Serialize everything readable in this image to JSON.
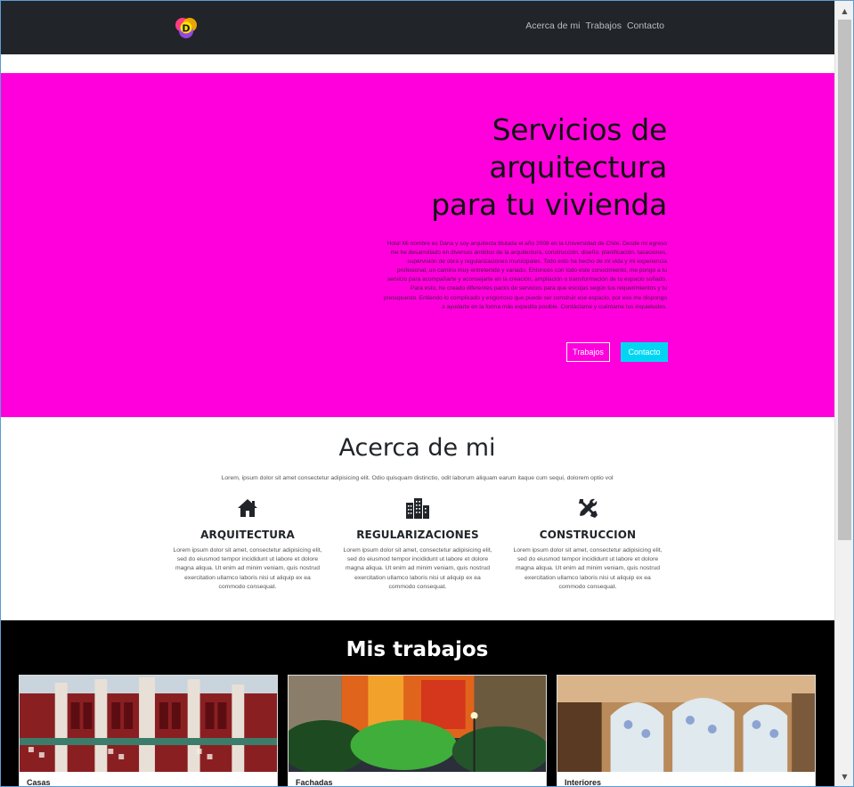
{
  "navbar": {
    "logo_letter": "D",
    "links": [
      "Acerca de mi",
      "Trabajos",
      "Contacto"
    ]
  },
  "hero": {
    "title_lines": [
      "Servicios de",
      "arquitectura",
      "para tu vivienda"
    ],
    "text": "Hola! Mi nombre es Dana y soy arquitecta titulada el año 2008 en la Universidad de Chile. Desde mi egreso me he desarrollado en diversos ámbitos de la arquitectura, construcción, diseño, planificación, tasaciones, supervisión de obra y regularizaciones municipales. Todo esto ha hecho de mi vida y mi experiencia profesional, un camino muy entretenido y variado. Entonces con todo este conocimiento, me pongo a tu servicio para acompañarte y aconsejarte en la creación, ampliación o transformación de tu espacio soñado. Para esto, he creado diferentes packs de servicios para que escojas según tus requerimientos y tu presupuesto. Entiendo lo complicado y engorroso que puede ser construir ese espacio, por eso me dispongo a ayudarte en la forma más expedita posible. Contáctame y cuéntame tus inquietudes.",
    "buttons": {
      "trabajos": "Trabajos",
      "contacto": "Contacto"
    },
    "bg_color": "#ff00dd",
    "contact_btn_color": "#00d6f2"
  },
  "about": {
    "title": "Acerca de mi",
    "subtitle": "Lorem, ipsum dolor sit amet consectetur adipisicing elit. Odio quisquam distinctio, odit laborum aliquam earum itaque cum sequi, dolorem optio vol",
    "services": [
      {
        "icon": "home-icon",
        "title": "ARQUITECTURA",
        "desc": "Lorem ipsum dolor sit amet, consectetur adipisicing elit, sed do eiusmod tempor incididunt ut labore et dolore magna aliqua. Ut enim ad minim veniam, quis nostrud exercitation ullamco laboris nisi ut aliquip ex ea commodo consequat."
      },
      {
        "icon": "city-icon",
        "title": "REGULARIZACIONES",
        "desc": "Lorem ipsum dolor sit amet, consectetur adipisicing elit, sed do eiusmod tempor incididunt ut labore et dolore magna aliqua. Ut enim ad minim veniam, quis nostrud exercitation ullamco laboris nisi ut aliquip ex ea commodo consequat."
      },
      {
        "icon": "tools-icon",
        "title": "CONSTRUCCION",
        "desc": "Lorem ipsum dolor sit amet, consectetur adipisicing elit, sed do eiusmod tempor incididunt ut labore et dolore magna aliqua. Ut enim ad minim veniam, quis nostrud exercitation ullamco laboris nisi ut aliquip ex ea commodo consequat."
      }
    ]
  },
  "works": {
    "title": "Mis trabajos",
    "cards": [
      {
        "caption": "Casas"
      },
      {
        "caption": "Fachadas"
      },
      {
        "caption": "Interiores"
      }
    ]
  }
}
